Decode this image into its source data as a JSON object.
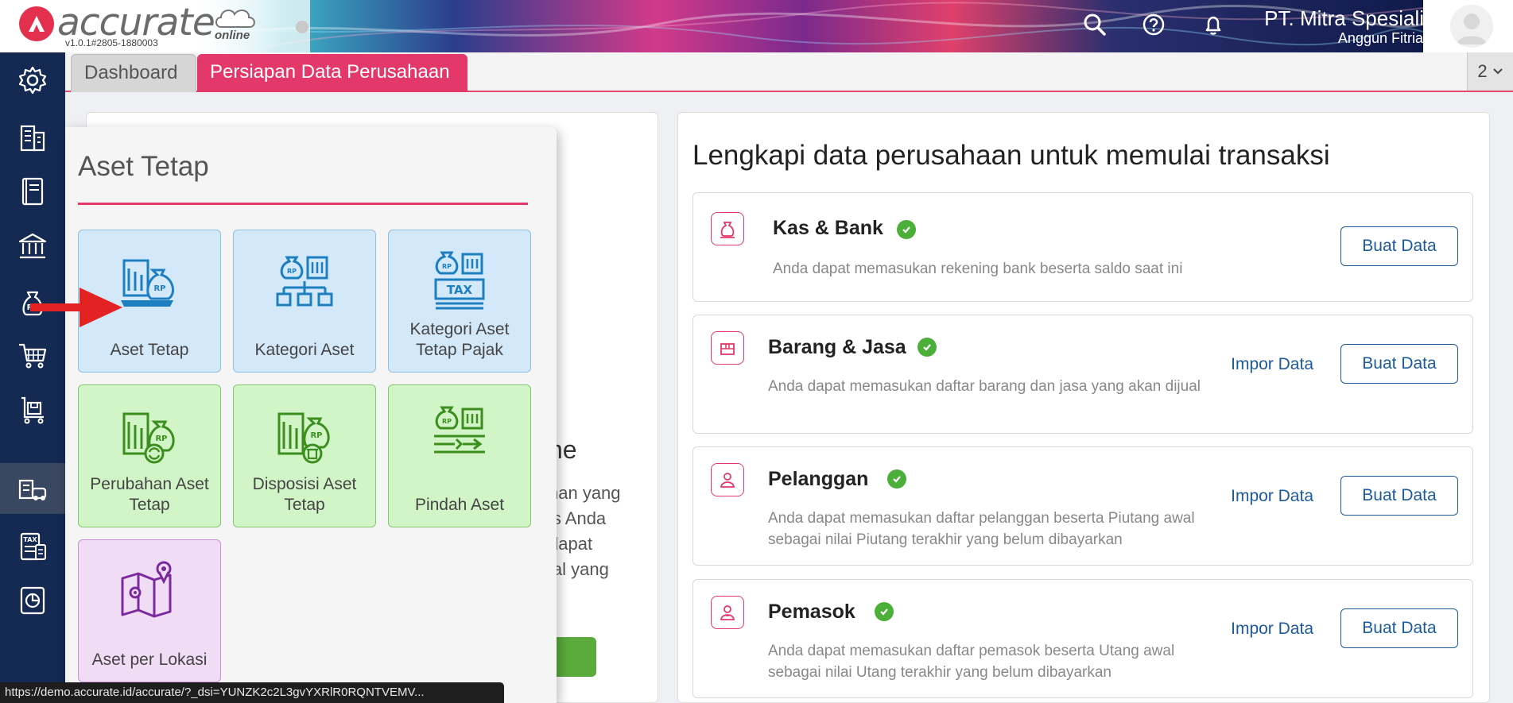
{
  "header": {
    "logo_text": "accurate",
    "logo_sub": "online",
    "version": "v1.0.1#2805-1880003",
    "company_name": "PT. Mitra Spesialis",
    "user_name": "Anggun Fitriani",
    "icons": [
      "search-icon",
      "help-icon",
      "bell-icon",
      "avatar"
    ]
  },
  "sidebar": {
    "items": [
      {
        "name": "settings",
        "icon": "gear-icon"
      },
      {
        "name": "company",
        "icon": "building-icon"
      },
      {
        "name": "ledger",
        "icon": "book-icon"
      },
      {
        "name": "bank",
        "icon": "bank-icon"
      },
      {
        "name": "receivable",
        "icon": "money-bag-icon"
      },
      {
        "name": "sales",
        "icon": "cart-icon"
      },
      {
        "name": "purchase",
        "icon": "trolley-icon"
      },
      {
        "name": "fixed-asset",
        "icon": "asset-icon",
        "active": true
      },
      {
        "name": "tax",
        "icon": "tax-icon"
      },
      {
        "name": "report",
        "icon": "report-icon"
      }
    ]
  },
  "tabs": {
    "dashboard": "Dashboard",
    "persiapan": "Persiapan Data Perusahaan",
    "count": "2"
  },
  "left_panel": {
    "heading_fragment": "ne",
    "para_lines": [
      "han yang",
      "is Anda",
      "dapat",
      "ial yang"
    ]
  },
  "right_panel": {
    "title": "Lengkapi data perusahaan untuk memulai transaksi",
    "impor_label": "Impor Data",
    "buat_label": "Buat Data",
    "cards": [
      {
        "title": "Kas & Bank",
        "desc": "Anda dapat memasukan rekening bank beserta saldo saat ini",
        "has_impor": false
      },
      {
        "title": "Barang & Jasa",
        "desc": "Anda dapat memasukan daftar barang dan jasa yang akan dijual",
        "has_impor": true
      },
      {
        "title": "Pelanggan",
        "desc": "Anda dapat memasukan daftar pelanggan beserta Piutang awal sebagai nilai Piutang terakhir yang belum dibayarkan",
        "has_impor": true
      },
      {
        "title": "Pemasok",
        "desc": "Anda dapat memasukan daftar pemasok beserta Utang awal sebagai nilai Utang terakhir yang belum dibayarkan",
        "has_impor": true
      }
    ]
  },
  "popup": {
    "title": "Aset Tetap",
    "tiles": [
      {
        "label": "Aset Tetap",
        "color": "blue"
      },
      {
        "label": "Kategori Aset",
        "color": "blue"
      },
      {
        "label": "Kategori Aset Tetap Pajak",
        "color": "blue"
      },
      {
        "label": "Perubahan Aset Tetap",
        "color": "green"
      },
      {
        "label": "Disposisi Aset Tetap",
        "color": "green"
      },
      {
        "label": "Pindah Aset",
        "color": "green"
      },
      {
        "label": "Aset per Lokasi",
        "color": "purple"
      }
    ]
  },
  "status_url": "https://demo.accurate.id/accurate/?_dsi=YUNZK2c2L3gvYXRlR0RQNTVEMV...",
  "colors": {
    "brand": "#e4386a",
    "sidebar": "#142a52",
    "link": "#1c5a9c",
    "check": "#4caf3a"
  }
}
